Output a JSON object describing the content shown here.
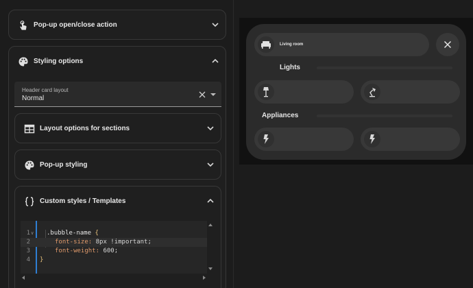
{
  "editor": {
    "popup_action": {
      "title": "Pop-up open/close action",
      "icon": "gesture-tap-icon"
    },
    "styling": {
      "title": "Styling options",
      "icon": "palette-icon",
      "header_layout": {
        "label": "Header card layout",
        "value": "Normal"
      },
      "sections": [
        {
          "title": "Layout options for sections",
          "icon": "table-icon"
        },
        {
          "title": "Pop-up styling",
          "icon": "palette-icon"
        }
      ],
      "custom": {
        "title": "Custom styles / Templates",
        "icon": "code-braces-icon",
        "code": {
          "line_numbers": [
            "1",
            "2",
            "3",
            "4"
          ],
          "line1_selector": ".bubble-name ",
          "line1_brace": "{",
          "line2_prop": "font-size:",
          "line2_value": " 8px !important;",
          "line3_prop": "font-weight:",
          "line3_value": " 600;",
          "line4_brace": "}"
        }
      }
    }
  },
  "preview": {
    "header_name": "Living room",
    "header_icon": "sofa-icon",
    "close_icon": "close-icon",
    "separators": [
      {
        "title": "Lights"
      },
      {
        "title": "Appliances"
      }
    ],
    "buttons": [
      {
        "icon": "floor-lamp-icon"
      },
      {
        "icon": "desk-lamp-icon"
      },
      {
        "icon": "flash-icon"
      },
      {
        "icon": "flash-icon"
      }
    ]
  }
}
